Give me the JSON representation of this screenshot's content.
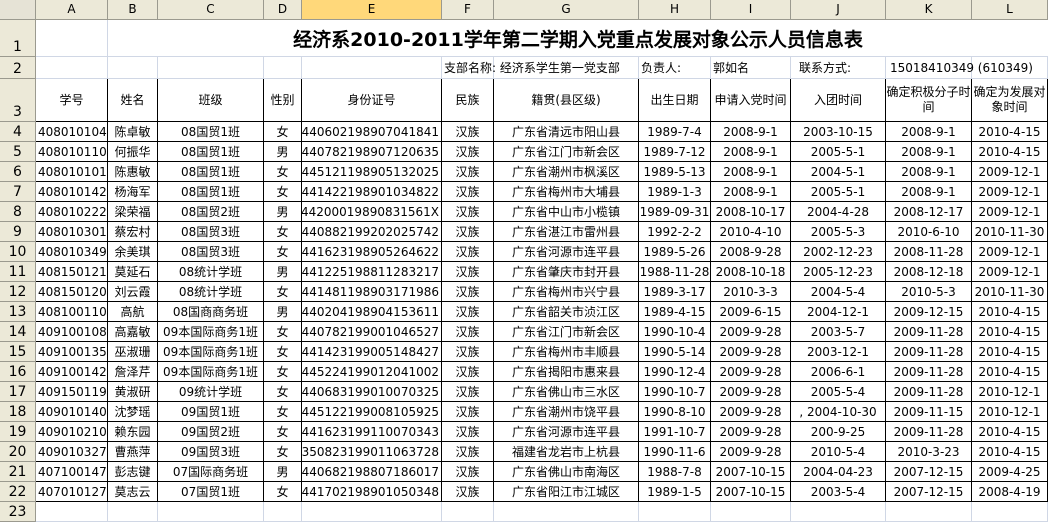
{
  "columns": [
    "A",
    "B",
    "C",
    "D",
    "E",
    "F",
    "G",
    "H",
    "I",
    "J",
    "K",
    "L"
  ],
  "selected_column": "E",
  "rows": [
    "1",
    "2",
    "3",
    "4",
    "5",
    "6",
    "7",
    "8",
    "9",
    "10",
    "11",
    "12",
    "13",
    "14",
    "15",
    "16",
    "17",
    "18",
    "19",
    "20",
    "21",
    "22",
    "23"
  ],
  "title": "经济系2010-2011学年第二学期入党重点发展对象公示人员信息表",
  "info": {
    "branch_label": "支部名称: 经济系学生第一党支部",
    "leader_label": "负责人:",
    "leader_name": "郭如名",
    "contact_label": "联系方式:",
    "contact_value": "15018410349 (610349)"
  },
  "headers": [
    "学号",
    "姓名",
    "班级",
    "性别",
    "身份证号",
    "民族",
    "籍贯(县区级)",
    "出生日期",
    "申请入党时间",
    "入团时间",
    "确定积极分子时间",
    "确定为发展对象时间"
  ],
  "records": [
    [
      "408010104",
      "陈卓敏",
      "08国贸1班",
      "女",
      "440602198907041841",
      "汉族",
      "广东省清远市阳山县",
      "1989-7-4",
      "2008-9-1",
      "2003-10-15",
      "2008-9-1",
      "2010-4-15"
    ],
    [
      "408010110",
      "何振华",
      "08国贸1班",
      "男",
      "440782198907120635",
      "汉族",
      "广东省江门市新会区",
      "1989-7-12",
      "2008-9-1",
      "2005-5-1",
      "2008-9-1",
      "2010-4-15"
    ],
    [
      "408010101",
      "陈惠敏",
      "08国贸1班",
      "女",
      "445121198905132025",
      "汉族",
      "广东省潮州市枫溪区",
      "1989-5-13",
      "2008-9-1",
      "2004-5-1",
      "2008-9-1",
      "2009-12-1"
    ],
    [
      "408010142",
      "杨海军",
      "08国贸1班",
      "女",
      "441422198901034822",
      "汉族",
      "广东省梅州市大埔县",
      "1989-1-3",
      "2008-9-1",
      "2005-5-1",
      "2008-9-1",
      "2009-12-1"
    ],
    [
      "408010222",
      "梁荣福",
      "08国贸2班",
      "男",
      "44200019890831561X",
      "汉族",
      "广东省中山市小榄镇",
      "1989-09-31",
      "2008-10-17",
      "2004-4-28",
      "2008-12-17",
      "2009-12-1"
    ],
    [
      "408010301",
      "蔡宏村",
      "08国贸3班",
      "女",
      "440882199202025742",
      "汉族",
      "广东省湛江市雷州县",
      "1992-2-2",
      "2010-4-10",
      "2005-5-3",
      "2010-6-10",
      "2010-11-30"
    ],
    [
      "408010349",
      "余美琪",
      "08国贸3班",
      "女",
      "441623198905264622",
      "汉族",
      "广东省河源市连平县",
      "1989-5-26",
      "2008-9-28",
      "2002-12-23",
      "2008-11-28",
      "2009-12-1"
    ],
    [
      "408150121",
      "莫延石",
      "08统计学班",
      "男",
      "441225198811283217",
      "汉族",
      "广东省肇庆市封开县",
      "1988-11-28",
      "2008-10-18",
      "2005-12-23",
      "2008-12-18",
      "2009-12-1"
    ],
    [
      "408150120",
      "刘云霞",
      "08统计学班",
      "女",
      "441481198903171986",
      "汉族",
      "广东省梅州市兴宁县",
      "1989-3-17",
      "2010-3-3",
      "2004-5-4",
      "2010-5-3",
      "2010-11-30"
    ],
    [
      "408100110",
      "高航",
      "08国商商务班",
      "男",
      "440204198904153611",
      "汉族",
      "广东省韶关市浈江区",
      "1989-4-15",
      "2009-6-15",
      "2004-12-1",
      "2009-12-15",
      "2010-4-15"
    ],
    [
      "409100108",
      "高嘉敏",
      "09本国际商务1班",
      "女",
      "440782199001046527",
      "汉族",
      "广东省江门市新会区",
      "1990-10-4",
      "2009-9-28",
      "2003-5-7",
      "2009-11-28",
      "2010-4-15"
    ],
    [
      "409100135",
      "巫淑珊",
      "09本国际商务1班",
      "女",
      "441423199005148427",
      "汉族",
      "广东省梅州市丰顺县",
      "1990-5-14",
      "2009-9-28",
      "2003-12-1",
      "2009-11-28",
      "2010-4-15"
    ],
    [
      "409100142",
      "詹泽芹",
      "09本国际商务1班",
      "女",
      "445224199012041002",
      "汉族",
      "广东省揭阳市惠来县",
      "1990-12-4",
      "2009-9-28",
      "2006-6-1",
      "2009-11-28",
      "2010-4-15"
    ],
    [
      "409150119",
      "黄淑研",
      "09统计学班",
      "女",
      "440683199010070325",
      "汉族",
      "广东省佛山市三水区",
      "1990-10-7",
      "2009-9-28",
      "2005-5-4",
      "2009-11-28",
      "2010-12-1"
    ],
    [
      "409010140",
      "沈梦瑶",
      "09国贸1班",
      "女",
      "445122199008105925",
      "汉族",
      "广东省潮州市饶平县",
      "1990-8-10",
      "2009-9-28",
      ", 2004-10-30",
      "2009-11-15",
      "2010-12-1"
    ],
    [
      "409010210",
      "赖东园",
      "09国贸2班",
      "女",
      "441623199110070343",
      "汉族",
      "广东省河源市连平县",
      "1991-10-7",
      "2009-9-28",
      "200-9-25",
      "2009-11-28",
      "2010-4-15"
    ],
    [
      "409010327",
      "曹燕萍",
      "09国贸3班",
      "女",
      "350823199011063728",
      "汉族",
      "福建省龙岩市上杭县",
      "1990-11-6",
      "2009-9-28",
      "2010-5-4",
      "2010-3-23",
      "2010-4-15"
    ],
    [
      "407100147",
      "彭志键",
      "07国际商务班",
      "男",
      "440682198807186017",
      "汉族",
      "广东省佛山市南海区",
      "1988-7-8",
      "2007-10-15",
      "2004-04-23",
      "2007-12-15",
      "2009-4-25"
    ],
    [
      "407010127",
      "莫志云",
      "07国贸1班",
      "女",
      "441702198901050348",
      "汉族",
      "广东省阳江市江城区",
      "1989-1-5",
      "2007-10-15",
      "2003-5-4",
      "2007-12-15",
      "2008-4-19"
    ]
  ]
}
